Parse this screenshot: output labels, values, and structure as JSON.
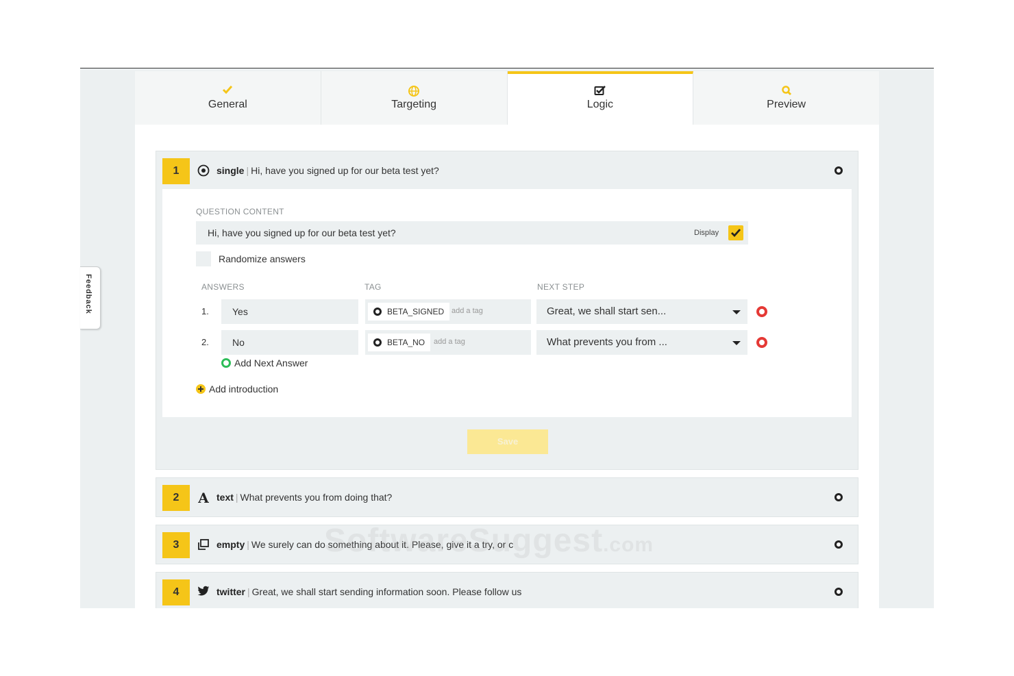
{
  "feedback": {
    "label": "Feedback"
  },
  "tabs": [
    {
      "label": "General",
      "icon": "check-icon",
      "active": false
    },
    {
      "label": "Targeting",
      "icon": "globe-icon",
      "active": false
    },
    {
      "label": "Logic",
      "icon": "checkbox-edit-icon",
      "active": true
    },
    {
      "label": "Preview",
      "icon": "search-icon",
      "active": false
    }
  ],
  "questions": [
    {
      "number": "1",
      "type": "single",
      "icon": "radio-icon",
      "text": "Hi, have you signed up for our beta test yet?",
      "expanded": true,
      "editor": {
        "content_label": "QUESTION CONTENT",
        "content_value": "Hi, have you signed up for our beta test yet?",
        "display_label": "Display",
        "display_checked": true,
        "randomize_label": "Randomize answers",
        "answers_header": "ANSWERS",
        "tag_header": "TAG",
        "next_step_header": "NEXT STEP",
        "answers": [
          {
            "index": "1.",
            "value": "Yes",
            "tag": "BETA_SIGNED",
            "tag_add": "add a tag",
            "next_step": "Great, we shall start sen..."
          },
          {
            "index": "2.",
            "value": "No",
            "tag": "BETA_NO",
            "tag_add": "add a tag",
            "next_step": "What prevents you from ..."
          }
        ],
        "add_next_answer": "Add Next Answer",
        "add_introduction": "Add introduction",
        "save_label": "Save"
      }
    },
    {
      "number": "2",
      "type": "text",
      "icon": "text-icon",
      "text": "What prevents you from doing that?"
    },
    {
      "number": "3",
      "type": "empty",
      "icon": "empty-icon",
      "text": "We surely can do something about it. Please, give it a try, or c"
    },
    {
      "number": "4",
      "type": "twitter",
      "icon": "twitter-icon",
      "text": "Great, we shall start sending information soon. Please follow us"
    }
  ],
  "watermark": {
    "main": "SoftwareSuggest",
    "suffix": ".com"
  },
  "colors": {
    "accent": "#f5c518",
    "add_green": "#2ebd59",
    "delete_red": "#e53935",
    "background": "#ecf0f1"
  }
}
